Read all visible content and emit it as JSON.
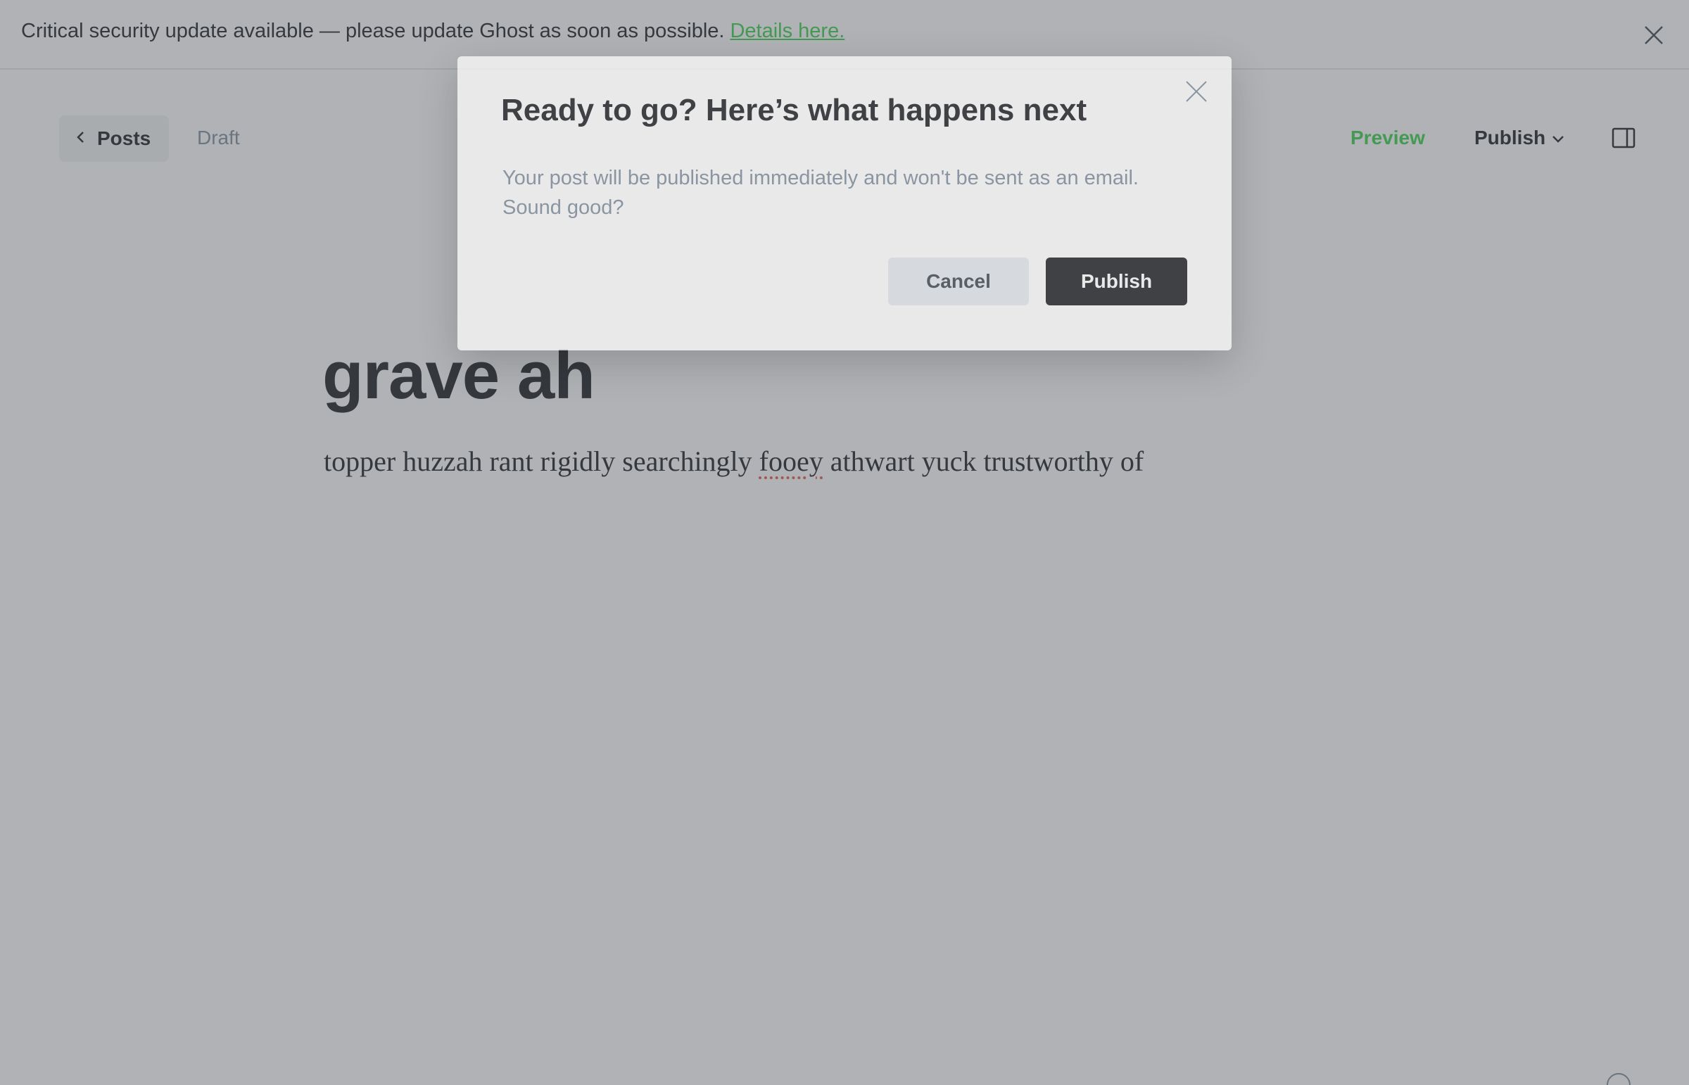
{
  "banner": {
    "message": "Critical security update available — please update Ghost as soon as possible.",
    "link": "Details here.",
    "close_icon": "close-icon"
  },
  "header": {
    "back_label": "Posts",
    "back_icon": "chevron-left-icon",
    "status": "Draft",
    "preview_label": "Preview",
    "publish_label": "Publish",
    "publish_icon": "chevron-down-icon",
    "sidebar_icon": "sidebar-toggle-icon"
  },
  "post": {
    "title": "grave ah",
    "body_before": "topper huzzah rant rigidly searchingly ",
    "body_misspelled": "fooey",
    "body_after": " athwart yuck trustworthy of"
  },
  "modal": {
    "title": "Ready to go? Here’s what happens next",
    "message": "Your post will be published immediately and won't be sent as an email. Sound good?",
    "cancel_label": "Cancel",
    "publish_label": "Publish",
    "close_icon": "close-icon"
  },
  "colors": {
    "accent": "#30cf43",
    "text": "#15171a",
    "muted": "#7c8b9a",
    "overlay": "#5a5e64"
  }
}
